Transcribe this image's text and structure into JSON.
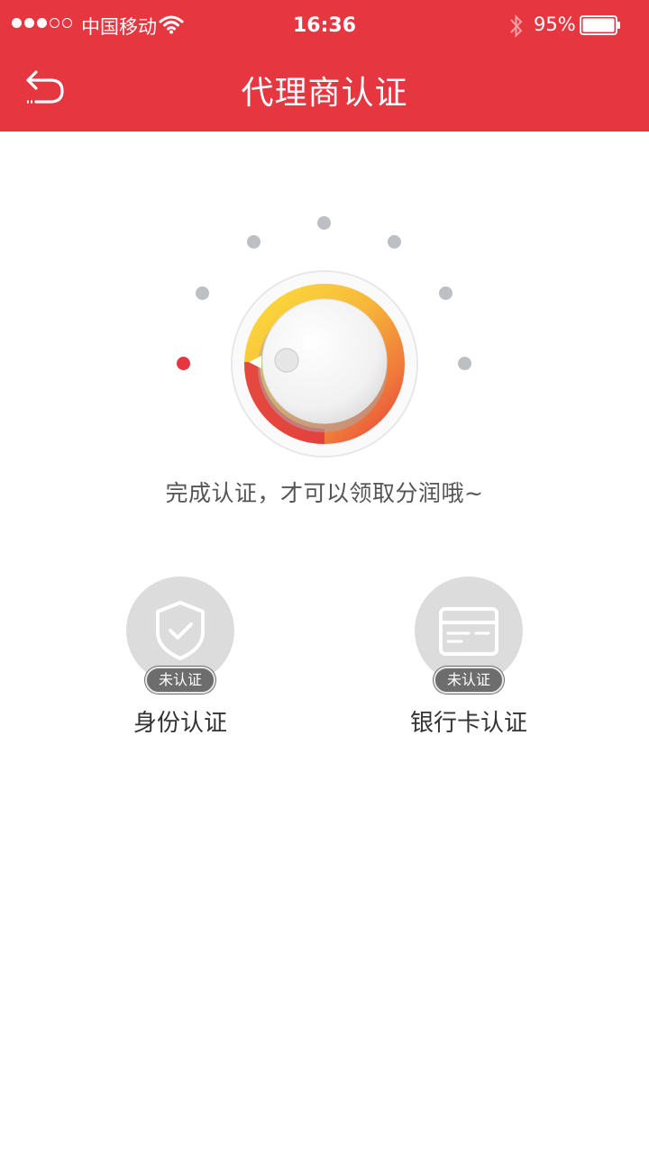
{
  "status_bar": {
    "carrier": "中国移动",
    "time": "16:36",
    "battery": "95%"
  },
  "header": {
    "title": "代理商认证"
  },
  "dial": {
    "level_steps": 7,
    "active_step": 1,
    "colors": {
      "accent": "#e63740",
      "arc_start": "#fcd93a",
      "arc_end": "#e63740"
    }
  },
  "hint": "完成认证，才可以领取分润哦~",
  "verifications": [
    {
      "label": "身份认证",
      "status": "未认证",
      "icon": "shield-check-icon"
    },
    {
      "label": "银行卡认证",
      "status": "未认证",
      "icon": "bank-card-icon"
    }
  ]
}
